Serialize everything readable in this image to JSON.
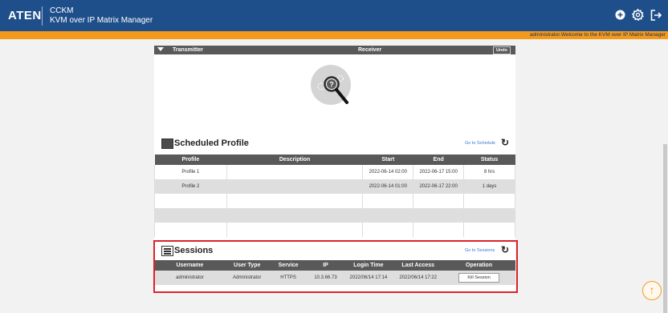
{
  "header": {
    "logo": "ATEN",
    "product_name": "CCKM",
    "product_subtitle": "KVM over IP Matrix Manager"
  },
  "welcome_text": "administrator.Welcome to the KVM over IP Matrix Manager",
  "matrix": {
    "transmitter_label": "Transmitter",
    "receiver_label": "Receiver",
    "undo_label": "Undo"
  },
  "scheduled_profile": {
    "title": "Scheduled Profile",
    "goto_label": "Go to Schedule",
    "columns": [
      "Profile",
      "Description",
      "Start",
      "End",
      "Status"
    ],
    "rows": [
      {
        "profile": "Profile 1",
        "description": "",
        "start": "2022-06-14 02:00",
        "end": "2022-06-17 15:00",
        "status": "8 hrs"
      },
      {
        "profile": "Profile 2",
        "description": "",
        "start": "2022-06-14 01:00",
        "end": "2022-06-17 22:00",
        "status": "1 days"
      }
    ]
  },
  "sessions": {
    "title": "Sessions",
    "goto_label": "Go to Sessions",
    "columns": [
      "Username",
      "User Type",
      "Service",
      "IP",
      "Login Time",
      "Last Access",
      "Operation"
    ],
    "rows": [
      {
        "username": "administrator",
        "user_type": "Administrator",
        "service": "HTTPS",
        "ip": "10.3.66.73",
        "login_time": "2022/06/14 17:14",
        "last_access": "2022/06/14 17:22",
        "operation": "Kill Session"
      }
    ]
  },
  "icons": {
    "add": "plus-circle-icon",
    "settings": "gear-icon",
    "logout": "logout-icon",
    "refresh": "refresh-icon",
    "scroll_top": "arrow-up-icon"
  },
  "colors": {
    "header_bg": "#1f4f8b",
    "accent_orange": "#f39a1d",
    "highlight_red": "#d9232a",
    "table_header": "#595959"
  }
}
